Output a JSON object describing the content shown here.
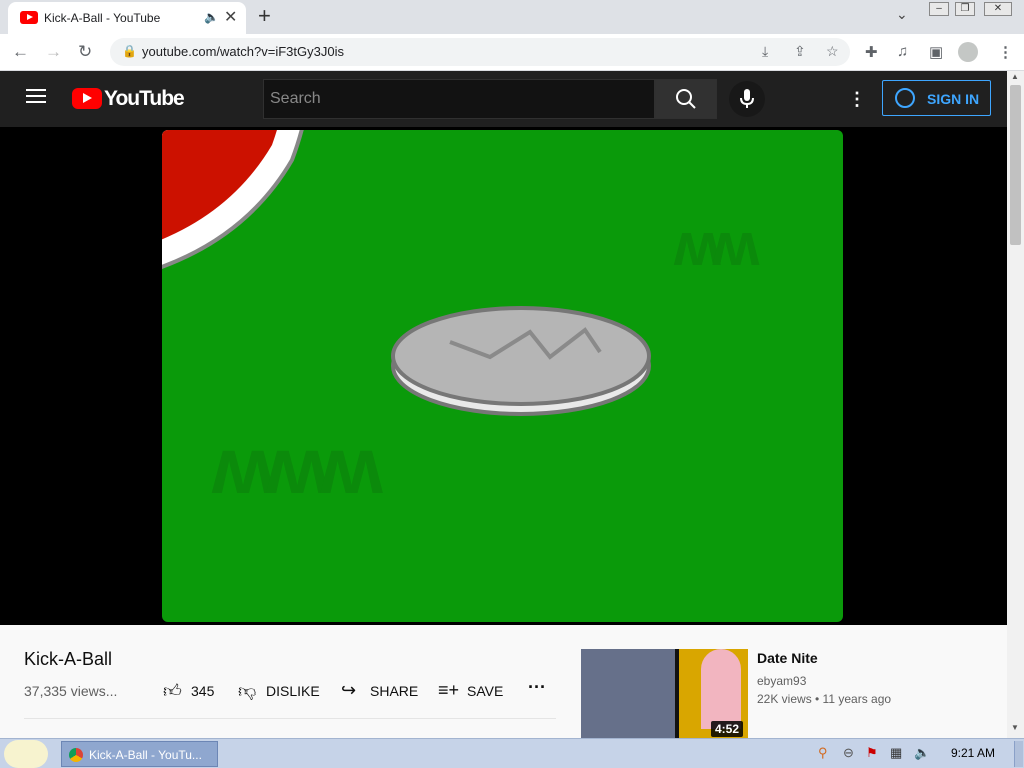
{
  "browser": {
    "tab_title": "Kick-A-Ball - YouTube",
    "new_tab": "+",
    "url": "youtube.com/watch?v=iF3tGy3J0is",
    "window_controls": [
      "minimize",
      "restore",
      "close"
    ]
  },
  "youtube": {
    "brand": "YouTube",
    "search_placeholder": "Search",
    "sign_in_label": "SIGN IN"
  },
  "video": {
    "title": "Kick-A-Ball",
    "views": "37,335 views...",
    "like_count": "345",
    "dislike_label": "DISLIKE",
    "share_label": "SHARE",
    "save_label": "SAVE"
  },
  "related": {
    "title": "Date Nite",
    "channel": "ebyam93",
    "meta": "22K views • 11 years ago",
    "duration": "4:52"
  },
  "taskbar": {
    "task_label": "Kick-A-Ball - YouTu...",
    "clock": "9:21 AM"
  },
  "colors": {
    "youtube_red": "#ff0000",
    "masthead_bg": "#202020",
    "accent_blue": "#3ea6ff",
    "video_green": "#0a9a0a"
  }
}
